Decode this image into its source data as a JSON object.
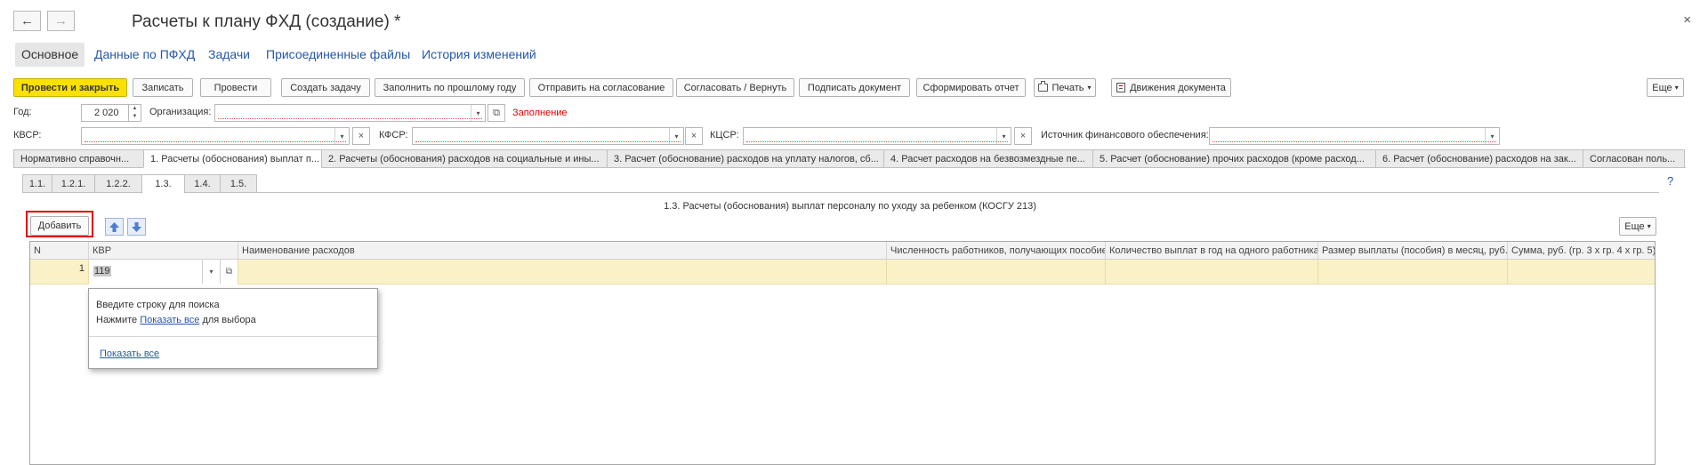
{
  "window": {
    "title": "Расчеты к плану ФХД (создание) *",
    "back_icon": "←",
    "forward_icon": "→",
    "close_icon": "×"
  },
  "section_tabs": [
    {
      "label": "Основное",
      "active": true
    },
    {
      "label": "Данные по ПФХД"
    },
    {
      "label": "Задачи"
    },
    {
      "label": "Присоединенные файлы"
    },
    {
      "label": "История изменений"
    }
  ],
  "toolbar": {
    "post_close": "Провести и закрыть",
    "save": "Записать",
    "post": "Провести",
    "create_task": "Создать задачу",
    "fill_prev_year": "Заполнить по прошлому году",
    "send_approval": "Отправить на согласование",
    "approve_return": "Согласовать / Вернуть",
    "sign": "Подписать документ",
    "report": "Сформировать отчет",
    "print": "Печать",
    "movements": "Движения документа",
    "more": "Еще"
  },
  "form": {
    "year_label": "Год:",
    "year_value": "2 020",
    "org_label": "Организация:",
    "org_value": "",
    "fill_warning": "Заполнение",
    "kvsr_label": "КВСР:",
    "kvsr_value": "",
    "kfsr_label": "КФСР:",
    "kfsr_value": "",
    "kcsr_label": "КЦСР:",
    "kcsr_value": "",
    "source_label": "Источник финансового обеспечения:",
    "source_value": ""
  },
  "main_tabs": [
    {
      "label": "Нормативно справочн..."
    },
    {
      "label": "1. Расчеты (обоснования) выплат п...",
      "active": true
    },
    {
      "label": "2. Расчеты (обоснования) расходов на социальные и ины..."
    },
    {
      "label": "3. Расчет (обоснование) расходов на уплату налогов, сб..."
    },
    {
      "label": "4. Расчет расходов на безвозмездные пе..."
    },
    {
      "label": "5. Расчет (обоснование) прочих расходов (кроме расход..."
    },
    {
      "label": "6. Расчет (обоснование) расходов на зак..."
    },
    {
      "label": "Согласован поль..."
    }
  ],
  "help_icon": "?",
  "sub_tabs": [
    {
      "label": "1.1."
    },
    {
      "label": "1.2.1."
    },
    {
      "label": "1.2.2."
    },
    {
      "label": "1.3.",
      "active": true
    },
    {
      "label": "1.4."
    },
    {
      "label": "1.5."
    }
  ],
  "table_section": {
    "title": "1.3. Расчеты (обоснования) выплат персоналу по уходу за ребенком (КОСГУ 213)",
    "add_button": "Добавить",
    "more": "Еще",
    "columns": [
      "N",
      "КВР",
      "Наименование расходов",
      "Численность работников, получающих пособие",
      "Количество выплат в год на одного работника",
      "Размер выплаты (пособия) в месяц, руб.",
      "Сумма, руб. (гр. 3 x гр. 4 x гр. 5)"
    ],
    "rows": [
      {
        "n": "1",
        "kvr": "119",
        "name": "",
        "count": "",
        "payments": "",
        "amount": "",
        "sum": ""
      }
    ]
  },
  "dropdown_popup": {
    "hint_line1": "Введите строку для поиска",
    "hint_prefix": "Нажмите",
    "hint_link": "Показать все",
    "hint_suffix": "для выбора",
    "show_all": "Показать все"
  },
  "colors": {
    "primary_button": "#fbe100",
    "link": "#2458a8",
    "warning": "#e00000",
    "selected_row": "#fbf1c7",
    "highlight_box": "#e00000",
    "arrow_button": "#4a7fd0"
  }
}
